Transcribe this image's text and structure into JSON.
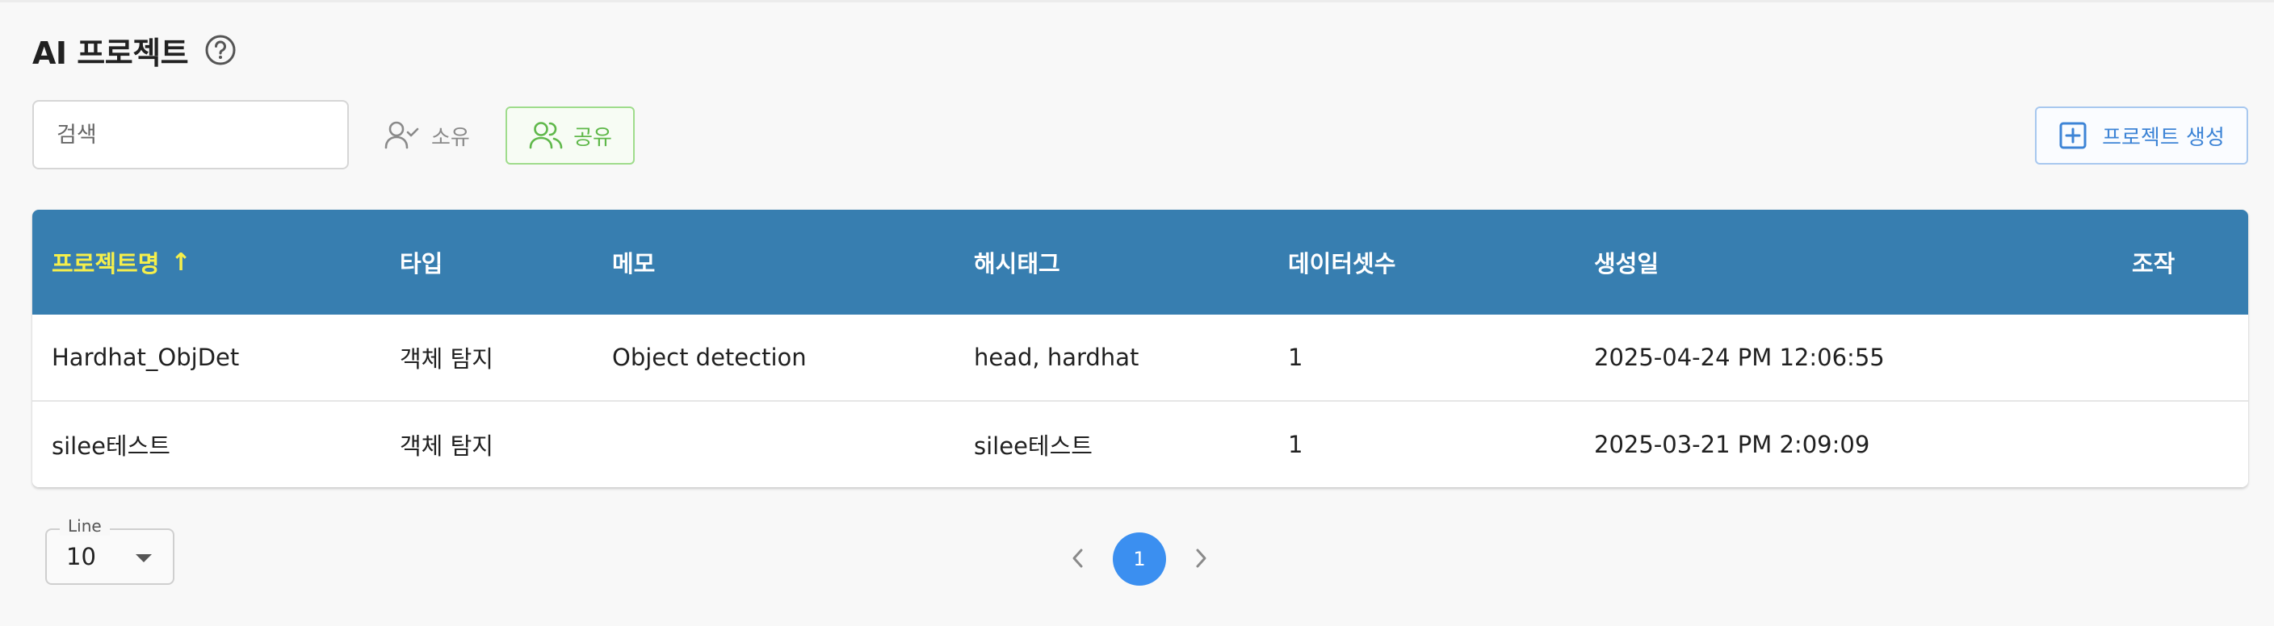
{
  "page": {
    "title": "AI 프로젝트"
  },
  "toolbar": {
    "search_placeholder": "검색",
    "search_value": "",
    "own_label": "소유",
    "share_label": "공유",
    "create_label": "프로젝트 생성"
  },
  "table": {
    "columns": [
      {
        "label": "프로젝트명",
        "sort_indicator": "↑"
      },
      {
        "label": "타입"
      },
      {
        "label": "메모"
      },
      {
        "label": "해시태그"
      },
      {
        "label": "데이터셋수"
      },
      {
        "label": "생성일"
      },
      {
        "label": "조작"
      }
    ],
    "rows": [
      {
        "name": "Hardhat_ObjDet",
        "type": "객체 탐지",
        "memo": "Object detection",
        "hashtags": "head, hardhat",
        "dataset_count": "1",
        "created": "2025-04-24 PM 12:06:55"
      },
      {
        "name": "silee테스트",
        "type": "객체 탐지",
        "memo": "",
        "hashtags": "silee테스트",
        "dataset_count": "1",
        "created": "2025-03-21 PM 2:09:09"
      }
    ]
  },
  "footer": {
    "line_label": "Line",
    "line_value": "10",
    "current_page": "1"
  },
  "colors": {
    "header_bg": "#377eb0",
    "sorted_header_text": "#f5ef4b",
    "share_accent": "#5fb84a",
    "create_accent": "#3d84d6",
    "active_page": "#3b8ff0"
  },
  "icons": {
    "help": "help-circle-icon",
    "own": "user-check-icon",
    "share": "users-icon",
    "create": "plus-square-icon",
    "line_dropdown": "caret-down-icon",
    "prev": "chevron-left-icon",
    "next": "chevron-right-icon"
  }
}
